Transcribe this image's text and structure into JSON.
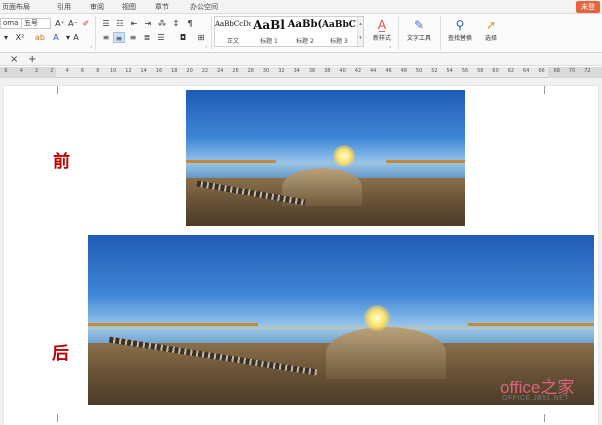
{
  "tabs": [
    "页面布局",
    "引用",
    "审阅",
    "视图",
    "章节",
    "办公空间"
  ],
  "login_label": "未登",
  "font": {
    "name": "oma",
    "size": "五号"
  },
  "style_gallery": [
    {
      "preview": "AaBbCcDd",
      "name": "正文"
    },
    {
      "preview": "AaBl",
      "name": "标题 1"
    },
    {
      "preview": "AaBb(",
      "name": "标题 2"
    },
    {
      "preview": "AaBbC",
      "name": "标题 3"
    }
  ],
  "buttons": {
    "new_style": "新样式",
    "text_tools": "文字工具",
    "find_replace": "查找替换",
    "select": "选择"
  },
  "doc_tab": {
    "close": "×",
    "add": "+"
  },
  "ruler_numbers": [
    "6",
    "4",
    "2",
    "2",
    "4",
    "6",
    "8",
    "10",
    "12",
    "14",
    "16",
    "18",
    "20",
    "22",
    "24",
    "26",
    "28",
    "30",
    "32",
    "34",
    "36",
    "38",
    "40",
    "42",
    "44",
    "46",
    "48",
    "50",
    "52",
    "54",
    "56",
    "58",
    "60",
    "62",
    "64",
    "66",
    "68",
    "70",
    "72"
  ],
  "document": {
    "before_label": "前",
    "after_label": "后"
  },
  "watermark": {
    "logo_text": "office之家",
    "url_text": "OFFICE.JB51.NET"
  },
  "icons": [
    "bullets-icon",
    "numbering-icon",
    "align-left-icon",
    "align-center-icon",
    "text-color-icon",
    "highlight-icon",
    "new-style-icon",
    "text-tools-icon",
    "find-replace-icon",
    "select-cursor-icon"
  ]
}
